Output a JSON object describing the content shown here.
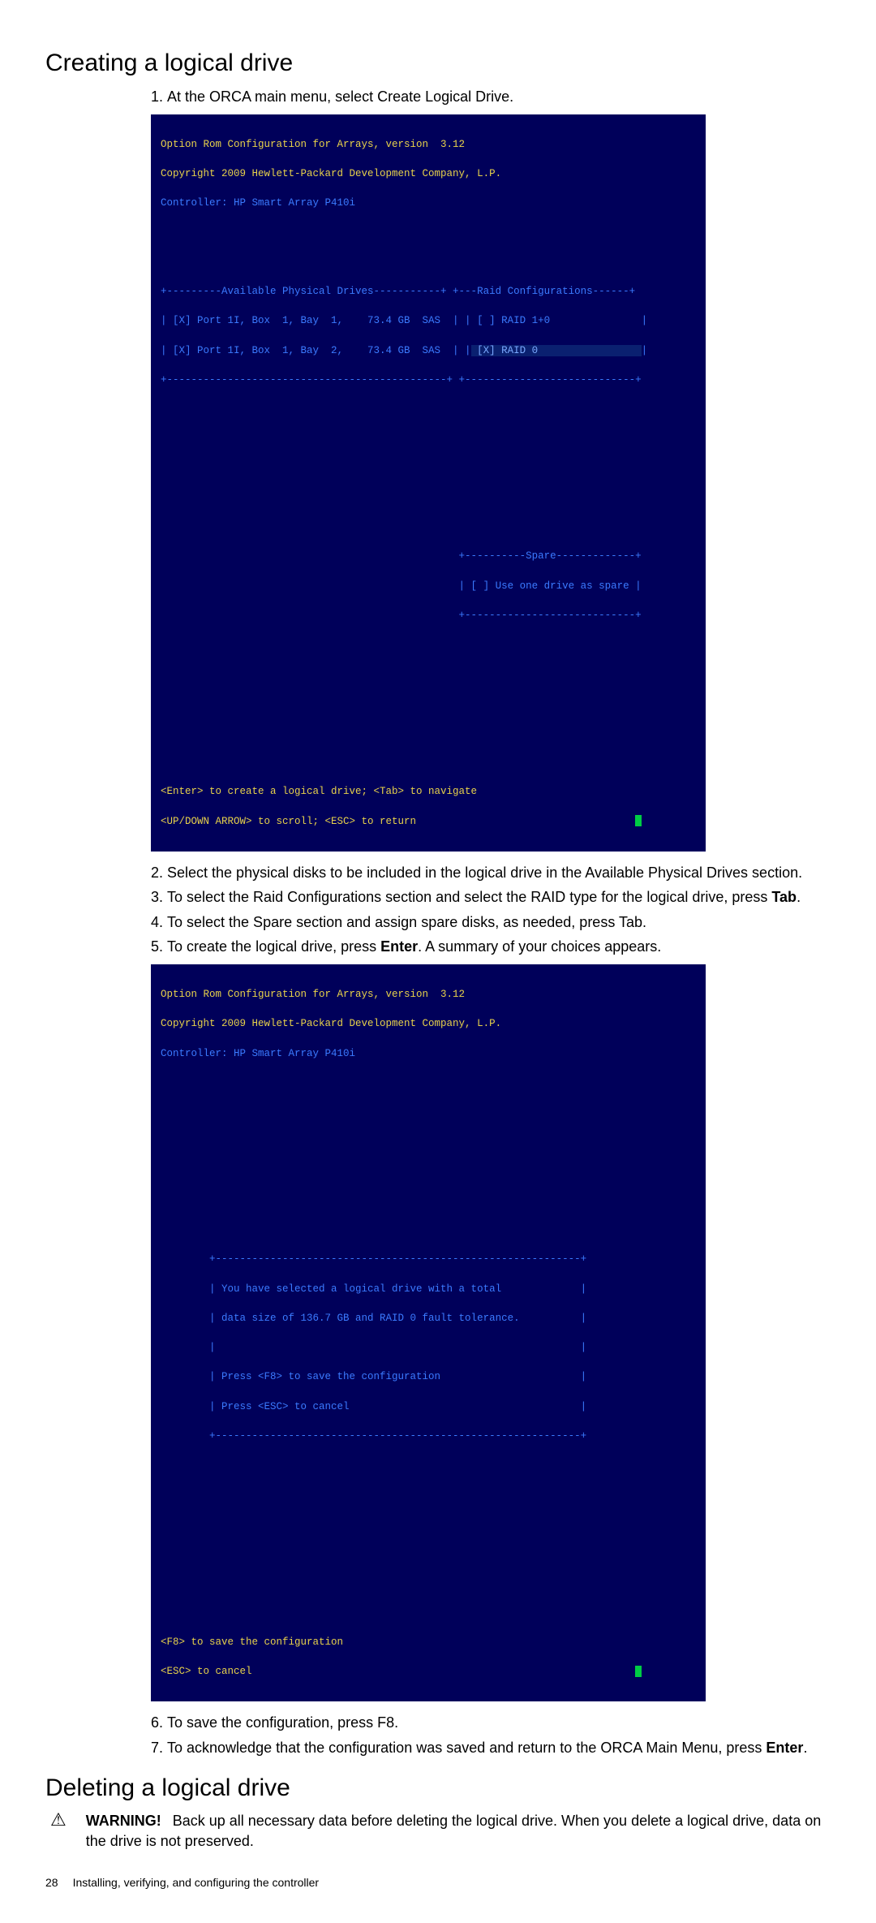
{
  "heading1": "Creating a logical drive",
  "step1": "At the ORCA main menu, select Create Logical Drive.",
  "term1": {
    "l1": "Option Rom Configuration for Arrays, version  3.12",
    "l2": "Copyright 2009 Hewlett-Packard Development Company, L.P.",
    "l3": "Controller: HP Smart Array P410i",
    "divA": "+---------Available Physical Drives-----------+ +---Raid Configurations------+",
    "row1a": "| [X] Port 1I, Box  1, Bay  1,    73.4 GB  SAS  | | [ ] RAID 1+0               |",
    "row2a": "| [X] Port 1I, Box  1, Bay  2,    73.4 GB  SAS  | |",
    "row2sel": " [X] RAID 0                 ",
    "row2end": "|",
    "divB": "+----------------------------------------------+ +----------------------------+",
    "spareTop": "                                                 +----------Spare-------------+",
    "spareRow": "                                                 | [ ] Use one drive as spare |",
    "spareBot": "                                                 +----------------------------+",
    "hint1": "<Enter> to create a logical drive; <Tab> to navigate",
    "hint2": "<UP/DOWN ARROW> to scroll; <ESC> to return"
  },
  "step2": "Select the physical disks to be included in the logical drive in the Available Physical Drives section.",
  "step3a": "To select the Raid Configurations section and select the RAID type for the logical drive, press ",
  "step3b": "Tab",
  "step3c": ".",
  "step4": "To select the Spare section and assign spare disks, as needed, press Tab.",
  "step5a": "To create the logical drive, press ",
  "step5b": "Enter",
  "step5c": ". A summary of your choices appears.",
  "term2": {
    "l1": "Option Rom Configuration for Arrays, version  3.12",
    "l2": "Copyright 2009 Hewlett-Packard Development Company, L.P.",
    "l3": "Controller: HP Smart Array P410i",
    "boxTop": "        +------------------------------------------------------------+",
    "box1": "        | You have selected a logical drive with a total             |",
    "box2": "        | data size of 136.7 GB and RAID 0 fault tolerance.          |",
    "box3": "        |                                                            |",
    "box4": "        | Press <F8> to save the configuration                       |",
    "box5": "        | Press <ESC> to cancel                                      |",
    "boxBot": "        +------------------------------------------------------------+",
    "hint1": "<F8> to save the configuration",
    "hint2": "<ESC> to cancel"
  },
  "step6": "To save the configuration, press F8.",
  "step7a": "To acknowledge that the configuration was saved and return to the ORCA Main Menu, press ",
  "step7b": "Enter",
  "step7c": ".",
  "heading2": "Deleting a logical drive",
  "warnLabel": "WARNING!",
  "warnText": "Back up all necessary data before deleting the logical drive. When you delete a logical drive, data on the drive is not preserved.",
  "pageNum": "28",
  "footerText": "Installing, verifying, and configuring the controller"
}
